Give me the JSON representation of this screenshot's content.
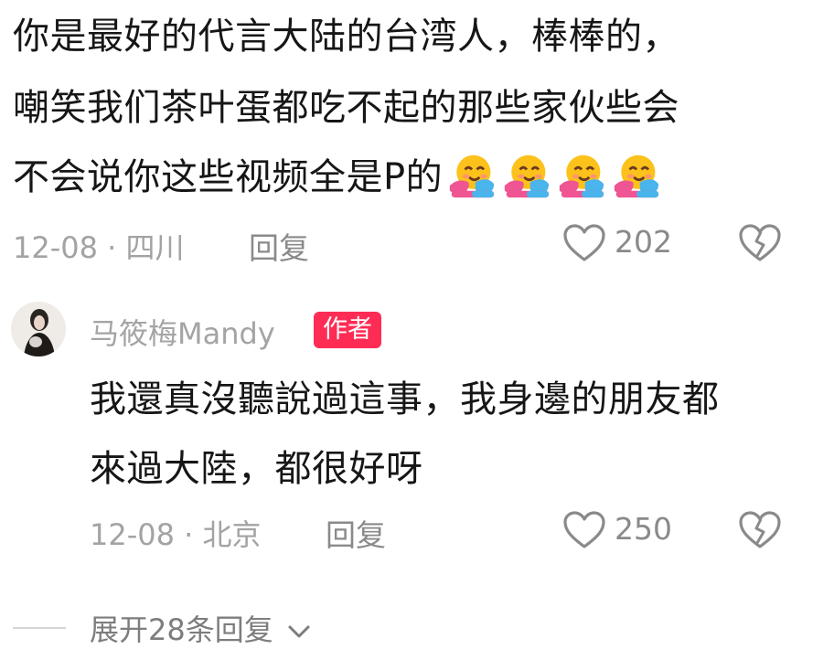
{
  "comment": {
    "lines": [
      "你是最好的代言大陆的台湾人，棒棒的，",
      "嘲笑我们茶叶蛋都吃不起的那些家伙些会",
      "不会说你这些视频全是P的"
    ],
    "emoji_icon": "hugging-face-icon",
    "date": "12-08",
    "separator": "·",
    "location": "四川",
    "reply_label": "回复",
    "like_count": "202"
  },
  "reply": {
    "author": "马筱梅Mandy",
    "badge": "作者",
    "lines": [
      "我還真沒聽說過這事，我身邊的朋友都",
      "來過大陸，都很好呀"
    ],
    "date": "12-08",
    "separator": "·",
    "location": "北京",
    "reply_label": "回复",
    "like_count": "250"
  },
  "expand": {
    "label": "展开28条回复"
  },
  "colors": {
    "text": "#161616",
    "meta": "#a3a3a3",
    "badge_bg": "#fe2c55",
    "badge_text": "#ffffff"
  }
}
